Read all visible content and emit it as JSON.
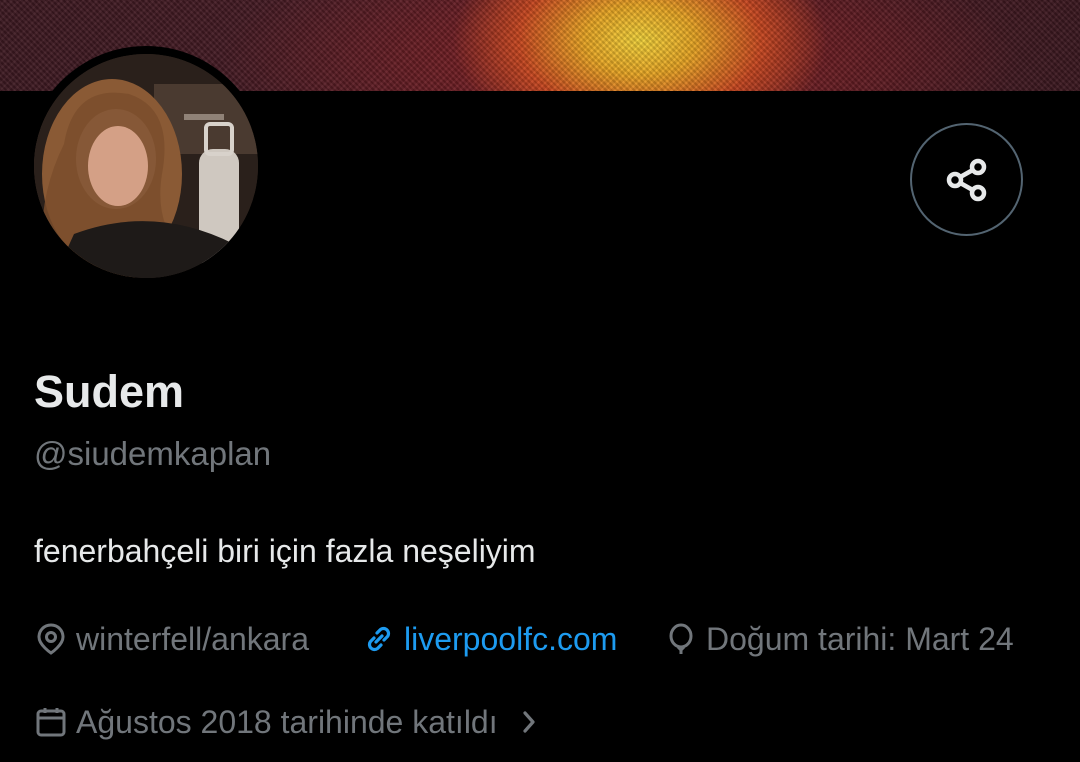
{
  "profile": {
    "display_name": "Sudem",
    "handle": "@siudemkaplan",
    "bio": "fenerbahçeli biri için fazla neşeliyim",
    "location": "winterfell/ankara",
    "website": "liverpoolfc.com",
    "birthday": "Doğum tarihi: Mart 24",
    "joined": "Ağustos 2018 tarihinde katıldı"
  },
  "icons": {
    "share": "share-icon",
    "location": "location-pin-icon",
    "website": "link-icon",
    "birthday": "balloon-icon",
    "joined": "calendar-icon",
    "chevron": "chevron-right-icon"
  },
  "colors": {
    "background": "#000000",
    "text_primary": "#e7e9ea",
    "text_secondary": "#71767b",
    "link": "#1d9bf0",
    "border": "#536471"
  }
}
